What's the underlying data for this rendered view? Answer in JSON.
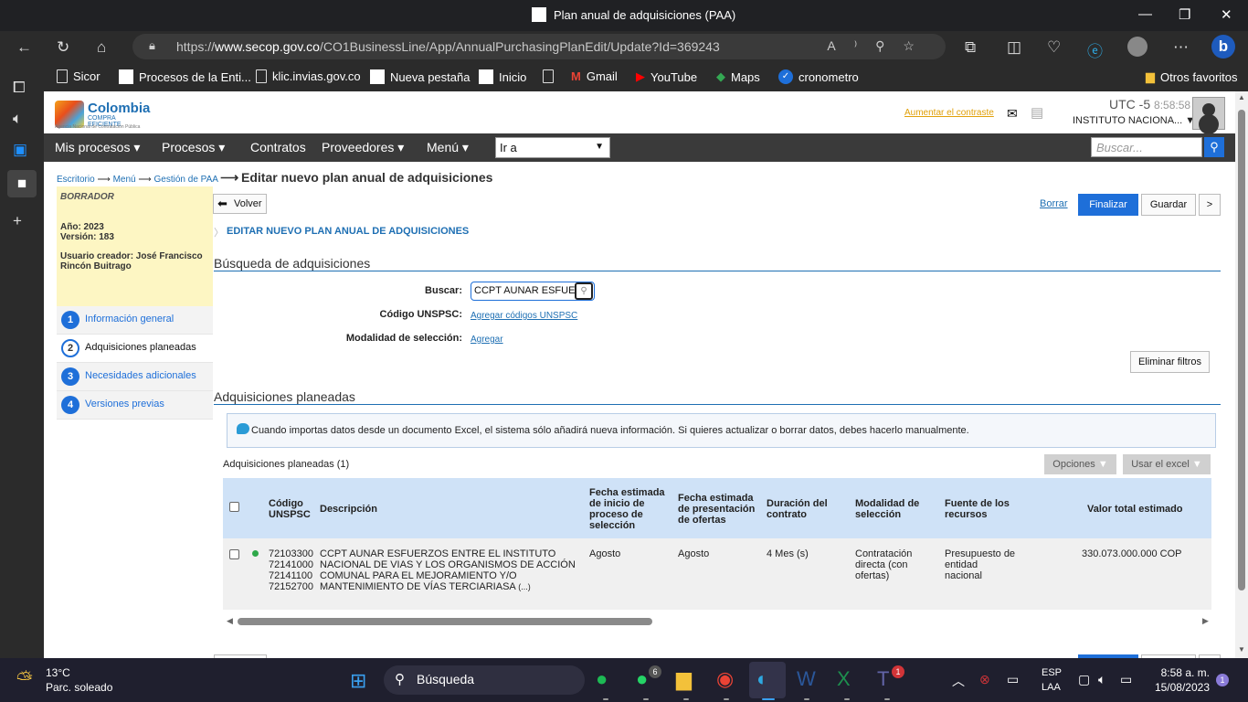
{
  "window": {
    "title": "Plan anual de adquisiciones (PAA)"
  },
  "browser": {
    "url_prefix": "https://",
    "url_host": "www.secop.gov.co",
    "url_path": "/CO1BusinessLine/App/AnnualPurchasingPlanEdit/Update?Id=369243",
    "favorites": [
      "Sicor",
      "Procesos de la Enti...",
      "klic.invias.gov.co",
      "Nueva pestaña",
      "Inicio",
      "Gmail",
      "YouTube",
      "Maps",
      "cronometro"
    ],
    "other_favorites": "Otros favoritos"
  },
  "header": {
    "logo_title": "Colombia",
    "logo_sub": "COMPRA EFICIENTE",
    "logo_agency": "Agencia Nacional de Contratación Pública",
    "increase_contrast": "Aumentar el contraste",
    "utc": "UTC -5",
    "time": "8:58:58",
    "institution": "INSTITUTO NACIONA..."
  },
  "menu": {
    "items": [
      "Mis procesos",
      "Procesos",
      "Contratos",
      "Proveedores",
      "Menú"
    ],
    "goto": "Ir a",
    "search_placeholder": "Buscar..."
  },
  "breadcrumb": {
    "items": [
      "Escritorio",
      "Menú",
      "Gestión de PAA"
    ],
    "current": "Editar nuevo plan anual de adquisiciones"
  },
  "draft": {
    "status": "BORRADOR",
    "year": "Año: 2023",
    "version": "Versión: 183",
    "creator": "Usuario creador: José Francisco Rincón Buitrago"
  },
  "steps": [
    {
      "num": "1",
      "label": "Información general"
    },
    {
      "num": "2",
      "label": "Adquisiciones planeadas"
    },
    {
      "num": "3",
      "label": "Necesidades adicionales"
    },
    {
      "num": "4",
      "label": "Versiones previas"
    }
  ],
  "actions": {
    "back": "Volver",
    "delete": "Borrar",
    "finish": "Finalizar",
    "save": "Guardar",
    "more": ">"
  },
  "edit_title": "EDITAR NUEVO PLAN ANUAL DE ADQUISICIONES",
  "search_section": {
    "title": "Búsqueda de adquisiciones",
    "search_label": "Buscar:",
    "search_value": "CCPT AUNAR ESFUE",
    "unspsc_label": "Código UNSPSC:",
    "unspsc_link": "Agregar códigos UNSPSC",
    "modality_label": "Modalidad de selección:",
    "modality_link": "Agregar",
    "clear_filters": "Eliminar filtros"
  },
  "planned": {
    "title": "Adquisiciones planeadas",
    "info": "Cuando importas datos desde un documento Excel, el sistema sólo añadirá nueva información. Si quieres actualizar o borrar datos, debes hacerlo manualmente.",
    "count_label": "Adquisiciones planeadas",
    "count": "(1)",
    "options": "Opciones",
    "use_excel": "Usar el excel",
    "columns": {
      "code": "Código UNSPSC",
      "description": "Descripción",
      "start_date": "Fecha estimada de inicio de proceso de selección",
      "offer_date": "Fecha estimada de presentación de ofertas",
      "duration": "Duración del contrato",
      "modality": "Modalidad de selección",
      "source": "Fuente de los recursos",
      "value": "Valor total estimado"
    },
    "rows": [
      {
        "codes": [
          "72103300",
          "72141000",
          "72141100",
          "72152700"
        ],
        "description": "CCPT AUNAR ESFUERZOS ENTRE EL INSTITUTO NACIONAL DE VIAS Y LOS ORGANISMOS DE ACCIÓN COMUNAL PARA EL MEJORAMIENTO Y/O MANTENIMIENTO DE VÍAS TERCIARIASA",
        "more": "(...)",
        "start_date": "Agosto",
        "offer_date": "Agosto",
        "duration": "4 Mes (s)",
        "modality": "Contratación directa (con ofertas)",
        "source": "Presupuesto de entidad nacional",
        "value": "330.073.000.000 COP"
      }
    ]
  },
  "taskbar": {
    "weather_temp": "13°C",
    "weather_desc": "Parc. soleado",
    "search": "Búsqueda",
    "lang": "ESP",
    "lang2": "LAA",
    "time": "8:58 a. m.",
    "date": "15/08/2023",
    "whatsapp_badge": "6",
    "teams_badge": "1",
    "notif_badge": "1"
  }
}
